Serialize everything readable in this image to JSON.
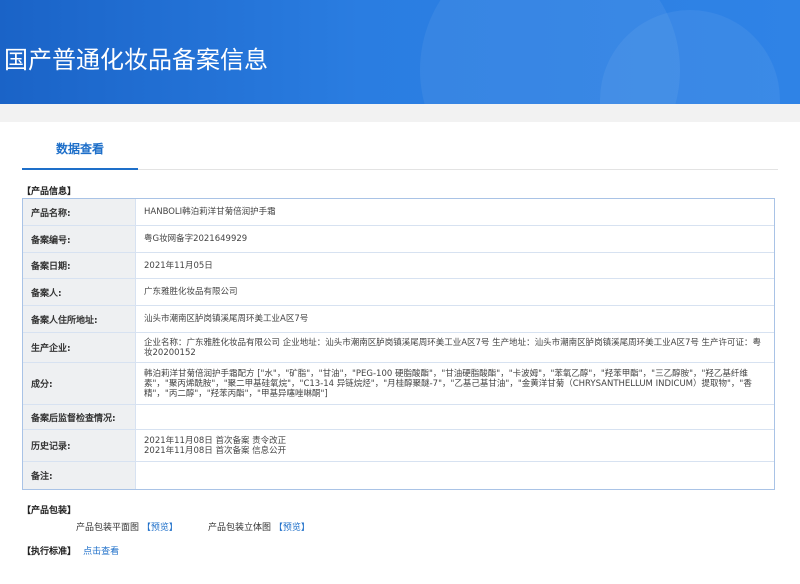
{
  "header": {
    "title": "国产普通化妆品备案信息"
  },
  "tabs": [
    {
      "label": "数据查看"
    }
  ],
  "product_info": {
    "section_label": "【产品信息】",
    "rows": [
      {
        "key": "产品名称:",
        "value": "HANBOLI韩泊莉洋甘菊倍润护手霜"
      },
      {
        "key": "备案编号:",
        "value": "粤G妆网备字2021649929"
      },
      {
        "key": "备案日期:",
        "value": "2021年11月05日"
      },
      {
        "key": "备案人:",
        "value": "广东雅胜化妆品有限公司"
      },
      {
        "key": "备案人住所地址:",
        "value": "汕头市潮南区胪岗镇溪尾周环美工业A区7号"
      },
      {
        "key": "生产企业:",
        "value": "企业名称：广东雅胜化妆品有限公司 企业地址：汕头市潮南区胪岗镇溪尾周环美工业A区7号 生产地址：汕头市潮南区胪岗镇溪尾周环美工业A区7号 生产许可证：粤妆20200152"
      },
      {
        "key": "成分:",
        "value": "韩泊莉洋甘菊倍润护手霜配方 [\"水\"，\"矿脂\"，\"甘油\"，\"PEG-100 硬脂酸酯\"，\"甘油硬脂酸酯\"，\"卡波姆\"，\"苯氧乙醇\"，\"羟苯甲酯\"，\"三乙醇胺\"，\"羟乙基纤维素\"，\"聚丙烯酰胺\"，\"聚二甲基硅氧烷\"，\"C13-14 异链烷烃\"，\"月桂醇聚醚-7\"，\"乙基己基甘油\"，\"金黄洋甘菊（CHRYSANTHELLUM INDICUM）提取物\"，\"香精\"，\"丙二醇\"，\"羟苯丙酯\"，\"甲基异噻唑啉酮\"]"
      },
      {
        "key": "备案后监督检查情况:",
        "value": ""
      },
      {
        "key": "历史记录:",
        "value": "2021年11月08日 首次备案 责令改正",
        "value2": "2021年11月08日 首次备案 信息公开"
      },
      {
        "key": "备注:",
        "value": ""
      }
    ]
  },
  "packaging": {
    "section_label": "【产品包装】",
    "flat_label": "产品包装平面图",
    "flat_link": "【预览】",
    "stereo_label": "产品包装立体图",
    "stereo_link": "【预览】"
  },
  "standard": {
    "section_label": "【执行标准】",
    "link": "点击查看"
  }
}
